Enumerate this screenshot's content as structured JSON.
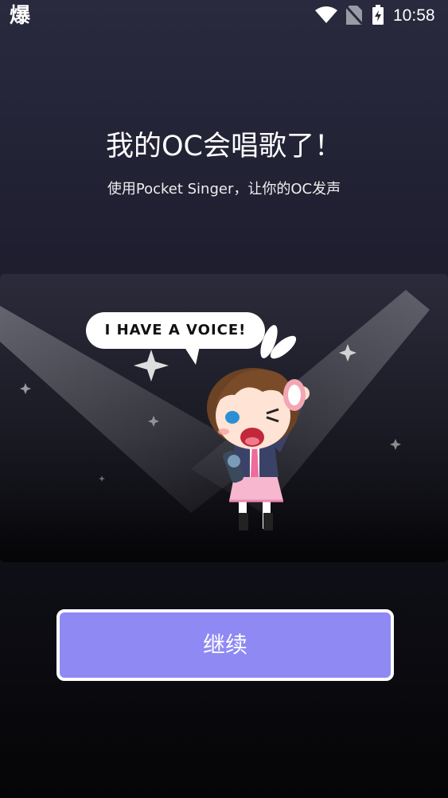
{
  "status_bar": {
    "app_glyph": "爆",
    "time": "10:58",
    "icons": [
      "wifi-icon",
      "no-sim-icon",
      "battery-charging-icon"
    ]
  },
  "headline": "我的OC会唱歌了！",
  "subtitle": "使用Pocket Singer，让你的OC发声",
  "illustration": {
    "speech_bubble": "I HAVE A VOICE!"
  },
  "continue_button": {
    "label": "继续"
  },
  "colors": {
    "button": "#8f89f4",
    "background_top": "#2a2a3f",
    "background_bottom": "#050507"
  }
}
